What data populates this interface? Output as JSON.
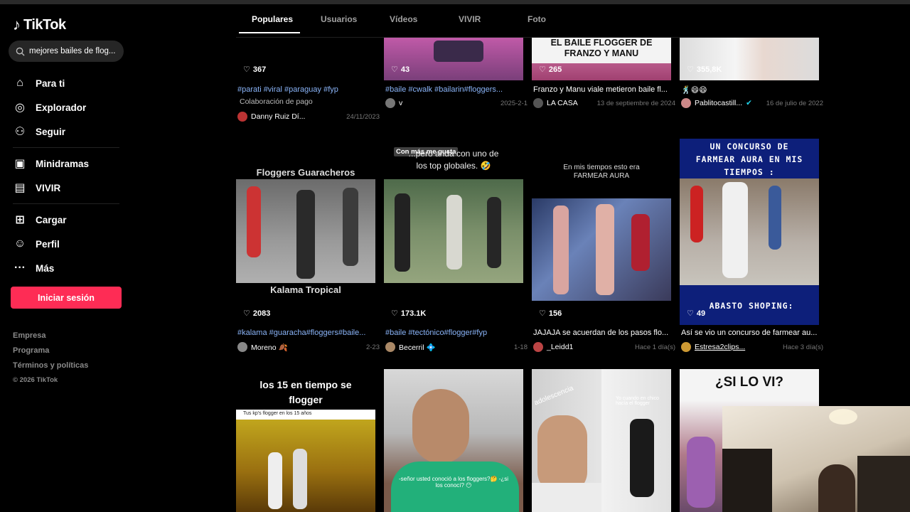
{
  "app": {
    "logo": "TikTok"
  },
  "search": {
    "value": "mejores bailes de flog..."
  },
  "nav": [
    {
      "label": "Para ti",
      "icon": "home-icon"
    },
    {
      "label": "Explorador",
      "icon": "compass-icon"
    },
    {
      "label": "Seguir",
      "icon": "user-follow-icon"
    },
    {
      "label": "Minidramas",
      "icon": "film-icon"
    },
    {
      "label": "VIVIR",
      "icon": "live-icon"
    },
    {
      "label": "Cargar",
      "icon": "plus-square-icon"
    },
    {
      "label": "Perfil",
      "icon": "user-icon"
    },
    {
      "label": "Más",
      "icon": "more-icon"
    }
  ],
  "login_label": "Iniciar sesión",
  "footer": {
    "company": "Empresa",
    "program": "Programa",
    "terms": "Términos y políticas",
    "copyright": "© 2026 TikTok"
  },
  "tabs": [
    "Populares",
    "Usuarios",
    "Vídeos",
    "VIVIR",
    "Foto"
  ],
  "row1": [
    {
      "likes": "367",
      "caption_tags": "#parati #viral #paraguay #fyp",
      "caption_sub": "Colaboración de pago",
      "author": "Danny Ruiz Dí...",
      "date": "24/11/2023"
    },
    {
      "likes": "43",
      "caption_tags": "#baile #cwalk #bailarin#floggers...",
      "author": "v",
      "date": "2025-2-1"
    },
    {
      "likes": "265",
      "overlay": "EL BAILE FLOGGER DE FRANZO Y MANU",
      "caption": "Franzo y Manu viale metieron baile fl...",
      "author": "LA CASA",
      "date": "13 de septiembre de 2024"
    },
    {
      "likes": "355,8K",
      "caption": "🕺😄😄",
      "author": "Pablitocastill...",
      "date": "16 de julio de 2022"
    }
  ],
  "row2": [
    {
      "likes": "2083",
      "overlay_top": "Floggers Guaracheros",
      "overlay_bottom": "Kalama Tropical",
      "caption_tags": "#kalama #guaracha#floggers#baile...",
      "author": "Moreno 🍂",
      "date": "2-23"
    },
    {
      "likes": "173.1K",
      "overlay_badge": "Con más me gusta",
      "overlay_top": "...pero anda con uno de los top globales. 🤣",
      "caption_tags": "#baile #tectónico#flogger#fyp",
      "author": "Becerril 💠",
      "date": "1-18"
    },
    {
      "likes": "156",
      "overlay_top": "En mis tiempos esto era FARMEAR AURA",
      "caption": "JAJAJA se acuerdan de los pasos flo...",
      "author": "_Leidd1",
      "date": "Hace 1 día(s)"
    },
    {
      "likes": "49",
      "overlay_top": "UN CONCURSO DE FARMEAR AURA EN MIS TIEMPOS :",
      "overlay_bottom": "ABASTO SHOPING:",
      "caption": "Así se vio un concurso de farmear au...",
      "author": "Estresa2clips...",
      "date": "Hace 3 día(s)"
    }
  ],
  "row3": [
    {
      "overlay_top": "los 15 en tiempo se flogger",
      "overlay_small": "Tus kp's flogger en los 15 años"
    },
    {
      "overlay_bottom": "-señor usted conoció a los floggers?🤔 -¿si los conocí? 😶"
    },
    {
      "overlay_top": "adolescencia",
      "overlay_small": "Yo cuando en chico hacía el flogger"
    },
    {
      "overlay_top": "¿SI LO VI?"
    }
  ],
  "colors": {
    "accent": "#fe2c55",
    "hashtag": "#8ab4f8",
    "background": "#000000"
  }
}
